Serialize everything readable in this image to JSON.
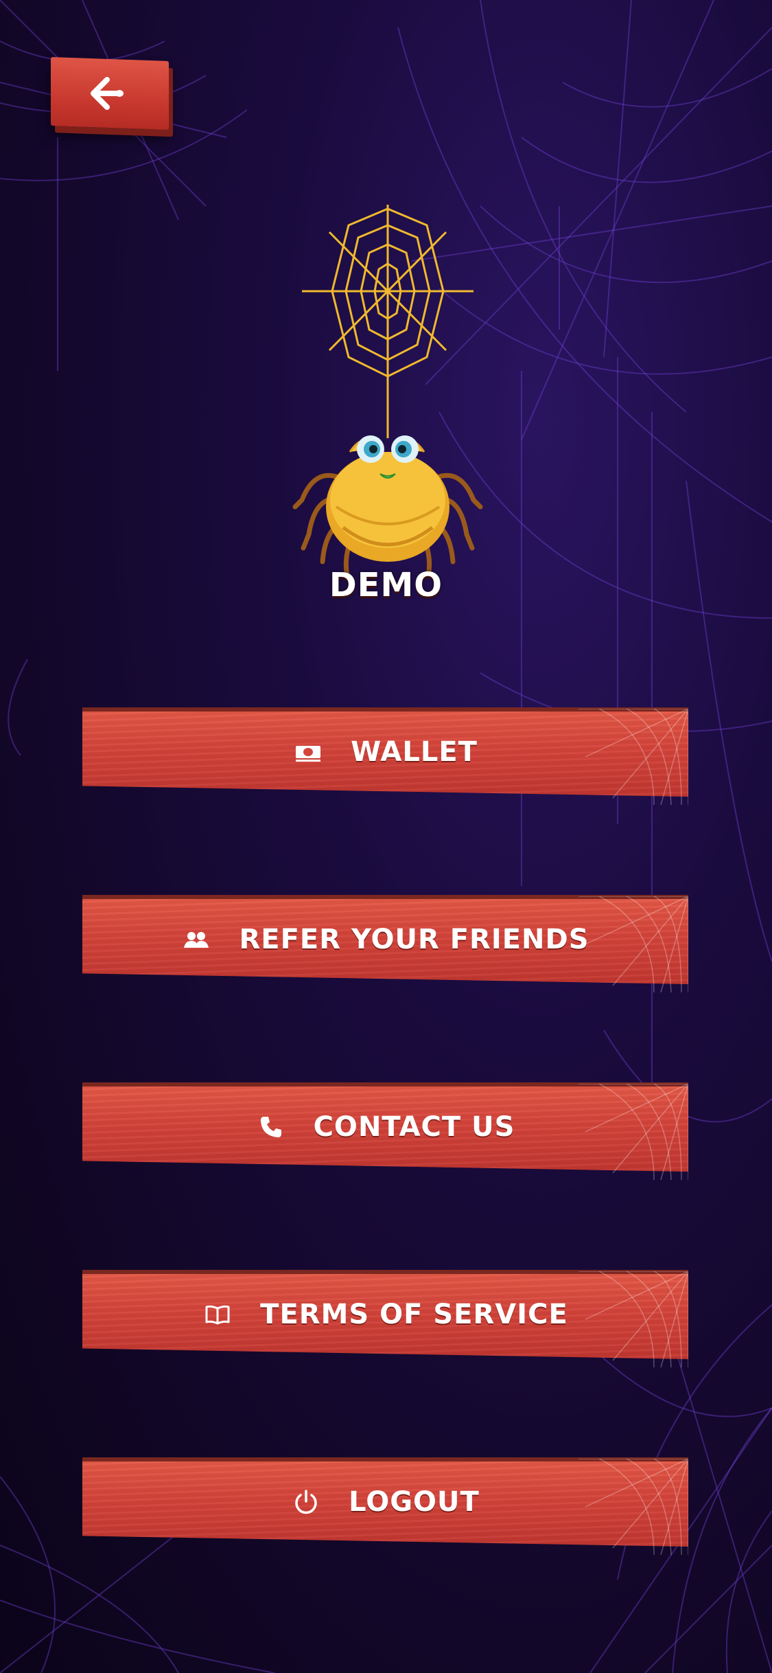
{
  "profile": {
    "username": "DEMO"
  },
  "menu": {
    "items": [
      {
        "label": "WALLET",
        "icon": "wallet-icon"
      },
      {
        "label": "REFER YOUR FRIENDS",
        "icon": "users-icon"
      },
      {
        "label": "CONTACT US",
        "icon": "phone-icon"
      },
      {
        "label": "TERMS OF SERVICE",
        "icon": "book-icon"
      },
      {
        "label": "LOGOUT",
        "icon": "power-icon"
      }
    ]
  },
  "navigation": {
    "back_icon": "arrow-left-icon"
  },
  "colors": {
    "background": "#140a30",
    "plank": "#d4443a",
    "plank_dark": "#7e1f1a",
    "web_purple": "#6b3cc8",
    "spider_yellow": "#f2b933",
    "label_text": "#ffffff"
  }
}
